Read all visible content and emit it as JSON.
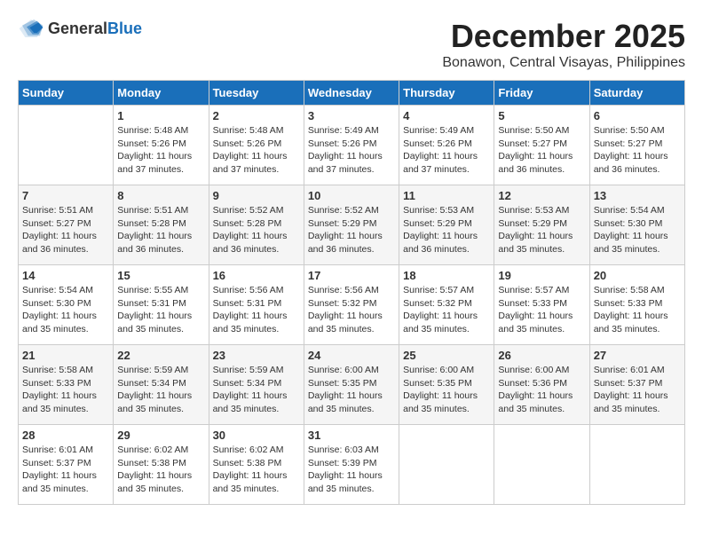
{
  "logo": {
    "general": "General",
    "blue": "Blue"
  },
  "header": {
    "month": "December 2025",
    "location": "Bonawon, Central Visayas, Philippines"
  },
  "weekdays": [
    "Sunday",
    "Monday",
    "Tuesday",
    "Wednesday",
    "Thursday",
    "Friday",
    "Saturday"
  ],
  "weeks": [
    [
      {
        "day": "",
        "sunrise": "",
        "sunset": "",
        "daylight": ""
      },
      {
        "day": "1",
        "sunrise": "Sunrise: 5:48 AM",
        "sunset": "Sunset: 5:26 PM",
        "daylight": "Daylight: 11 hours and 37 minutes."
      },
      {
        "day": "2",
        "sunrise": "Sunrise: 5:48 AM",
        "sunset": "Sunset: 5:26 PM",
        "daylight": "Daylight: 11 hours and 37 minutes."
      },
      {
        "day": "3",
        "sunrise": "Sunrise: 5:49 AM",
        "sunset": "Sunset: 5:26 PM",
        "daylight": "Daylight: 11 hours and 37 minutes."
      },
      {
        "day": "4",
        "sunrise": "Sunrise: 5:49 AM",
        "sunset": "Sunset: 5:26 PM",
        "daylight": "Daylight: 11 hours and 37 minutes."
      },
      {
        "day": "5",
        "sunrise": "Sunrise: 5:50 AM",
        "sunset": "Sunset: 5:27 PM",
        "daylight": "Daylight: 11 hours and 36 minutes."
      },
      {
        "day": "6",
        "sunrise": "Sunrise: 5:50 AM",
        "sunset": "Sunset: 5:27 PM",
        "daylight": "Daylight: 11 hours and 36 minutes."
      }
    ],
    [
      {
        "day": "7",
        "sunrise": "Sunrise: 5:51 AM",
        "sunset": "Sunset: 5:27 PM",
        "daylight": "Daylight: 11 hours and 36 minutes."
      },
      {
        "day": "8",
        "sunrise": "Sunrise: 5:51 AM",
        "sunset": "Sunset: 5:28 PM",
        "daylight": "Daylight: 11 hours and 36 minutes."
      },
      {
        "day": "9",
        "sunrise": "Sunrise: 5:52 AM",
        "sunset": "Sunset: 5:28 PM",
        "daylight": "Daylight: 11 hours and 36 minutes."
      },
      {
        "day": "10",
        "sunrise": "Sunrise: 5:52 AM",
        "sunset": "Sunset: 5:29 PM",
        "daylight": "Daylight: 11 hours and 36 minutes."
      },
      {
        "day": "11",
        "sunrise": "Sunrise: 5:53 AM",
        "sunset": "Sunset: 5:29 PM",
        "daylight": "Daylight: 11 hours and 36 minutes."
      },
      {
        "day": "12",
        "sunrise": "Sunrise: 5:53 AM",
        "sunset": "Sunset: 5:29 PM",
        "daylight": "Daylight: 11 hours and 35 minutes."
      },
      {
        "day": "13",
        "sunrise": "Sunrise: 5:54 AM",
        "sunset": "Sunset: 5:30 PM",
        "daylight": "Daylight: 11 hours and 35 minutes."
      }
    ],
    [
      {
        "day": "14",
        "sunrise": "Sunrise: 5:54 AM",
        "sunset": "Sunset: 5:30 PM",
        "daylight": "Daylight: 11 hours and 35 minutes."
      },
      {
        "day": "15",
        "sunrise": "Sunrise: 5:55 AM",
        "sunset": "Sunset: 5:31 PM",
        "daylight": "Daylight: 11 hours and 35 minutes."
      },
      {
        "day": "16",
        "sunrise": "Sunrise: 5:56 AM",
        "sunset": "Sunset: 5:31 PM",
        "daylight": "Daylight: 11 hours and 35 minutes."
      },
      {
        "day": "17",
        "sunrise": "Sunrise: 5:56 AM",
        "sunset": "Sunset: 5:32 PM",
        "daylight": "Daylight: 11 hours and 35 minutes."
      },
      {
        "day": "18",
        "sunrise": "Sunrise: 5:57 AM",
        "sunset": "Sunset: 5:32 PM",
        "daylight": "Daylight: 11 hours and 35 minutes."
      },
      {
        "day": "19",
        "sunrise": "Sunrise: 5:57 AM",
        "sunset": "Sunset: 5:33 PM",
        "daylight": "Daylight: 11 hours and 35 minutes."
      },
      {
        "day": "20",
        "sunrise": "Sunrise: 5:58 AM",
        "sunset": "Sunset: 5:33 PM",
        "daylight": "Daylight: 11 hours and 35 minutes."
      }
    ],
    [
      {
        "day": "21",
        "sunrise": "Sunrise: 5:58 AM",
        "sunset": "Sunset: 5:33 PM",
        "daylight": "Daylight: 11 hours and 35 minutes."
      },
      {
        "day": "22",
        "sunrise": "Sunrise: 5:59 AM",
        "sunset": "Sunset: 5:34 PM",
        "daylight": "Daylight: 11 hours and 35 minutes."
      },
      {
        "day": "23",
        "sunrise": "Sunrise: 5:59 AM",
        "sunset": "Sunset: 5:34 PM",
        "daylight": "Daylight: 11 hours and 35 minutes."
      },
      {
        "day": "24",
        "sunrise": "Sunrise: 6:00 AM",
        "sunset": "Sunset: 5:35 PM",
        "daylight": "Daylight: 11 hours and 35 minutes."
      },
      {
        "day": "25",
        "sunrise": "Sunrise: 6:00 AM",
        "sunset": "Sunset: 5:35 PM",
        "daylight": "Daylight: 11 hours and 35 minutes."
      },
      {
        "day": "26",
        "sunrise": "Sunrise: 6:00 AM",
        "sunset": "Sunset: 5:36 PM",
        "daylight": "Daylight: 11 hours and 35 minutes."
      },
      {
        "day": "27",
        "sunrise": "Sunrise: 6:01 AM",
        "sunset": "Sunset: 5:37 PM",
        "daylight": "Daylight: 11 hours and 35 minutes."
      }
    ],
    [
      {
        "day": "28",
        "sunrise": "Sunrise: 6:01 AM",
        "sunset": "Sunset: 5:37 PM",
        "daylight": "Daylight: 11 hours and 35 minutes."
      },
      {
        "day": "29",
        "sunrise": "Sunrise: 6:02 AM",
        "sunset": "Sunset: 5:38 PM",
        "daylight": "Daylight: 11 hours and 35 minutes."
      },
      {
        "day": "30",
        "sunrise": "Sunrise: 6:02 AM",
        "sunset": "Sunset: 5:38 PM",
        "daylight": "Daylight: 11 hours and 35 minutes."
      },
      {
        "day": "31",
        "sunrise": "Sunrise: 6:03 AM",
        "sunset": "Sunset: 5:39 PM",
        "daylight": "Daylight: 11 hours and 35 minutes."
      },
      {
        "day": "",
        "sunrise": "",
        "sunset": "",
        "daylight": ""
      },
      {
        "day": "",
        "sunrise": "",
        "sunset": "",
        "daylight": ""
      },
      {
        "day": "",
        "sunrise": "",
        "sunset": "",
        "daylight": ""
      }
    ]
  ]
}
